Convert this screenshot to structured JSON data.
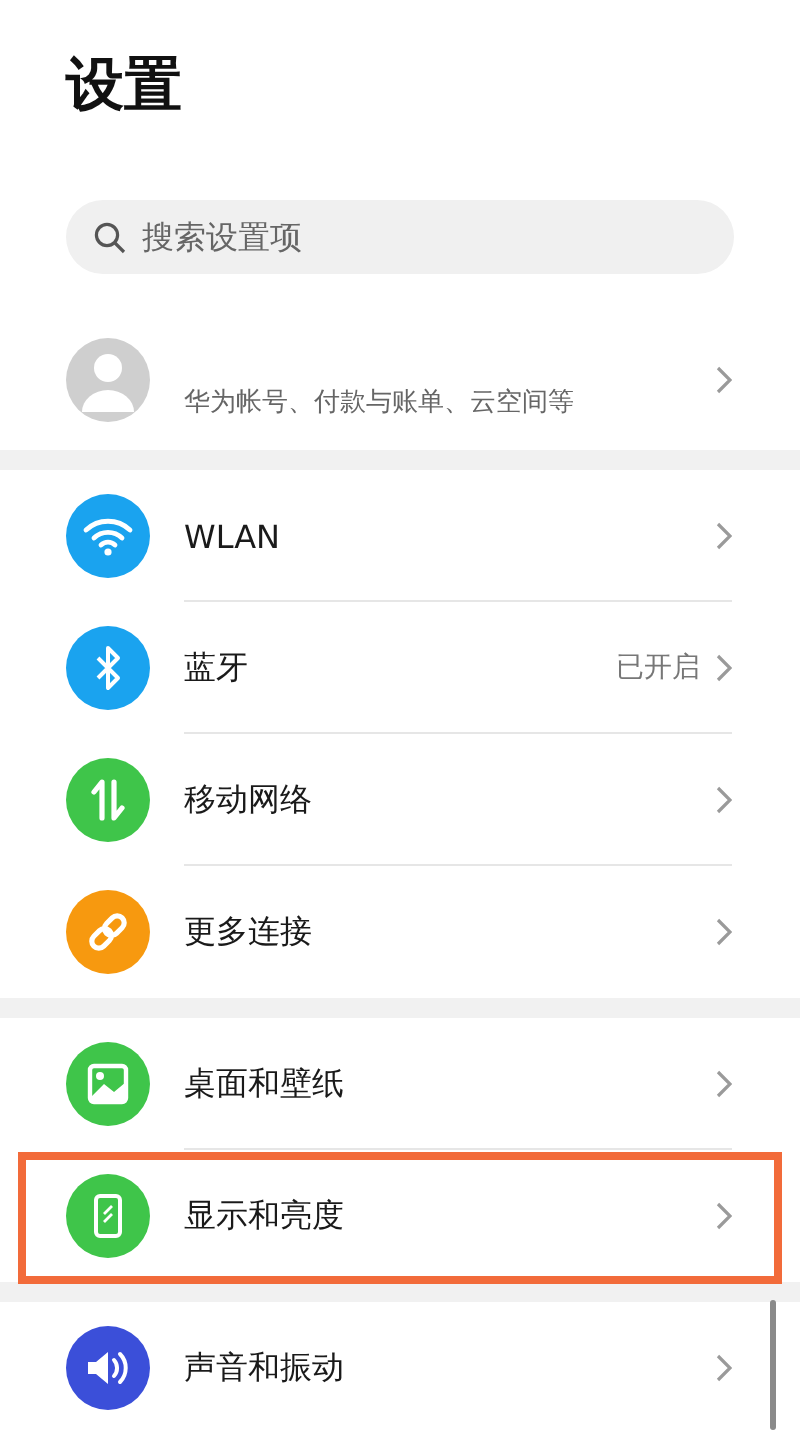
{
  "title": "设置",
  "search": {
    "placeholder": "搜索设置项"
  },
  "account": {
    "subtitle": "华为帐号、付款与账单、云空间等"
  },
  "groups": [
    {
      "items": [
        {
          "kind": "wifi",
          "color": "#1aa3ef",
          "label": "WLAN",
          "highlighted": false
        },
        {
          "kind": "bluetooth",
          "color": "#1aa3ef",
          "label": "蓝牙",
          "status": "已开启",
          "highlighted": false
        },
        {
          "kind": "mobile-data",
          "color": "#3fc54a",
          "label": "移动网络",
          "highlighted": false
        },
        {
          "kind": "link",
          "color": "#f7990f",
          "label": "更多连接",
          "highlighted": false
        }
      ]
    },
    {
      "items": [
        {
          "kind": "wallpaper",
          "color": "#3fc54a",
          "label": "桌面和壁纸",
          "highlighted": false
        },
        {
          "kind": "display",
          "color": "#3fc54a",
          "label": "显示和亮度",
          "highlighted": true
        }
      ]
    },
    {
      "items": [
        {
          "kind": "sound",
          "color": "#3b4fd9",
          "label": "声音和振动",
          "highlighted": false
        }
      ]
    }
  ]
}
